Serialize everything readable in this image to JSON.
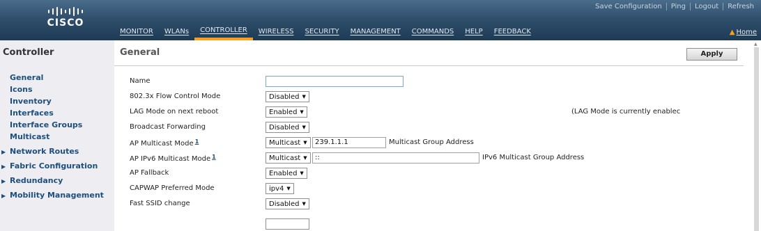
{
  "brand": {
    "logo_text": "CISCO"
  },
  "top_links": [
    "Save Configuration",
    "Ping",
    "Logout",
    "Refresh"
  ],
  "nav": [
    "MONITOR",
    "WLANs",
    "CONTROLLER",
    "WIRELESS",
    "SECURITY",
    "MANAGEMENT",
    "COMMANDS",
    "HELP",
    "FEEDBACK"
  ],
  "nav_active": "CONTROLLER",
  "home_label": "Home",
  "colors": {
    "header": "#2f4f6c",
    "accent": "#f8a01e",
    "link": "#1d4f7c"
  },
  "sidebar": {
    "title": "Controller",
    "items": [
      {
        "label": "General",
        "expandable": false
      },
      {
        "label": "Icons",
        "expandable": false
      },
      {
        "label": "Inventory",
        "expandable": false
      },
      {
        "label": "Interfaces",
        "expandable": false
      },
      {
        "label": "Interface Groups",
        "expandable": false
      },
      {
        "label": "Multicast",
        "expandable": false
      },
      {
        "label": "Network Routes",
        "expandable": true
      },
      {
        "label": "Fabric Configuration",
        "expandable": true
      },
      {
        "label": "Redundancy",
        "expandable": true
      },
      {
        "label": "Mobility Management",
        "expandable": true
      }
    ]
  },
  "main": {
    "title": "General",
    "apply_label": "Apply",
    "lag_status": "(LAG Mode is currently enablec",
    "fields": {
      "name": {
        "label": "Name",
        "value": ""
      },
      "flow_control": {
        "label": "802.3x Flow Control Mode",
        "value": "Disabled"
      },
      "lag_mode": {
        "label": "LAG Mode on next reboot",
        "value": "Enabled"
      },
      "broadcast": {
        "label": "Broadcast Forwarding",
        "value": "Disabled"
      },
      "ap_multicast": {
        "label": "AP Multicast Mode",
        "help": "1",
        "value": "Multicast",
        "group_address": "239.1.1.1",
        "group_label": "Multicast Group Address"
      },
      "ap_ipv6_multicast": {
        "label": "AP IPv6 Multicast Mode",
        "help": "1",
        "value": "Multicast",
        "group_address": "::",
        "group_label": "IPv6 Multicast Group Address"
      },
      "ap_fallback": {
        "label": "AP Fallback",
        "value": "Enabled"
      },
      "capwap_mode": {
        "label": "CAPWAP Preferred Mode",
        "value": "ipv4"
      },
      "fast_ssid": {
        "label": "Fast SSID change",
        "value": "Disabled"
      }
    }
  }
}
